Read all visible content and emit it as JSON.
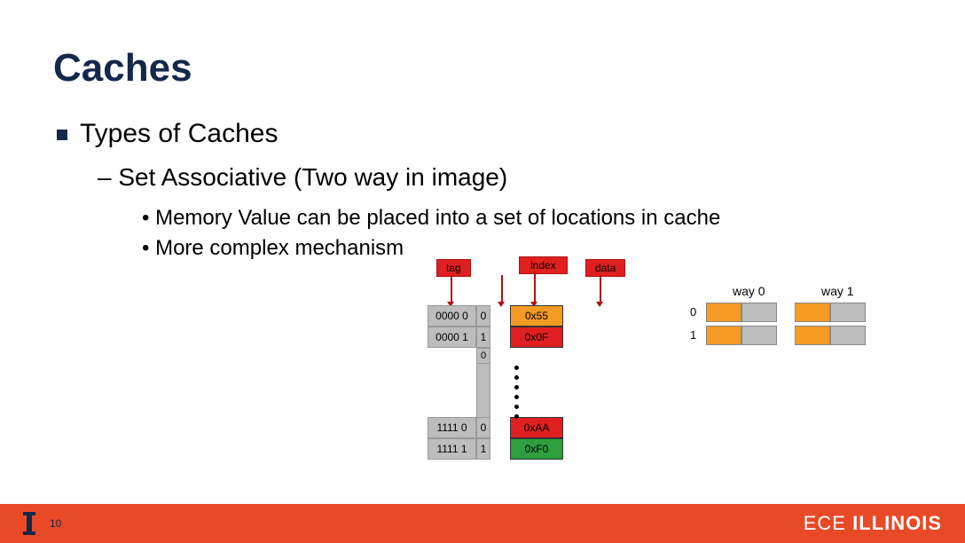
{
  "title": "Caches",
  "bullet1": "Types of Caches",
  "bullet2": "– Set Associative (Two way in image)",
  "bullet3a": "• Memory Value can be placed into a set of locations in cache",
  "bullet3b": "• More complex mechanism",
  "labels": {
    "tag": "tag",
    "index": "index",
    "data": "data"
  },
  "memory": {
    "rows_top": [
      {
        "tag": "0000 0",
        "idx": "0",
        "data": "0x55",
        "cls": "d-orange"
      },
      {
        "tag": "0000 1",
        "idx": "1",
        "data": "0x0F",
        "cls": "d-red"
      }
    ],
    "mid_idx": "0",
    "rows_bottom": [
      {
        "tag": "1111 0",
        "idx": "0",
        "data": "0xAA",
        "cls": "d-red"
      },
      {
        "tag": "1111 1",
        "idx": "1",
        "data": "0xF0",
        "cls": "d-green"
      }
    ]
  },
  "ways": {
    "way0_label": "way 0",
    "way1_label": "way 1",
    "row_indices": [
      "0",
      "1"
    ]
  },
  "footer": {
    "page": "10",
    "brand_light": "ECE ",
    "brand_bold": "ILLINOIS"
  }
}
